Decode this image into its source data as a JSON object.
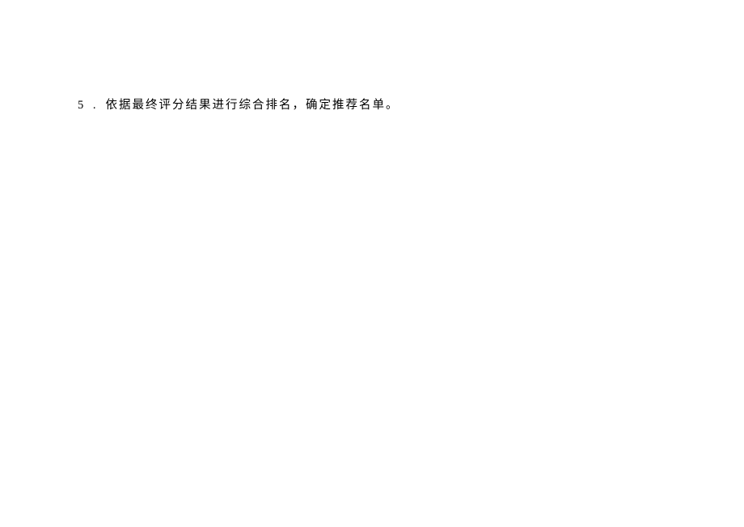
{
  "document": {
    "item": {
      "number": "5 .",
      "text": "依据最终评分结果进行综合排名，确定推荐名单。"
    }
  }
}
